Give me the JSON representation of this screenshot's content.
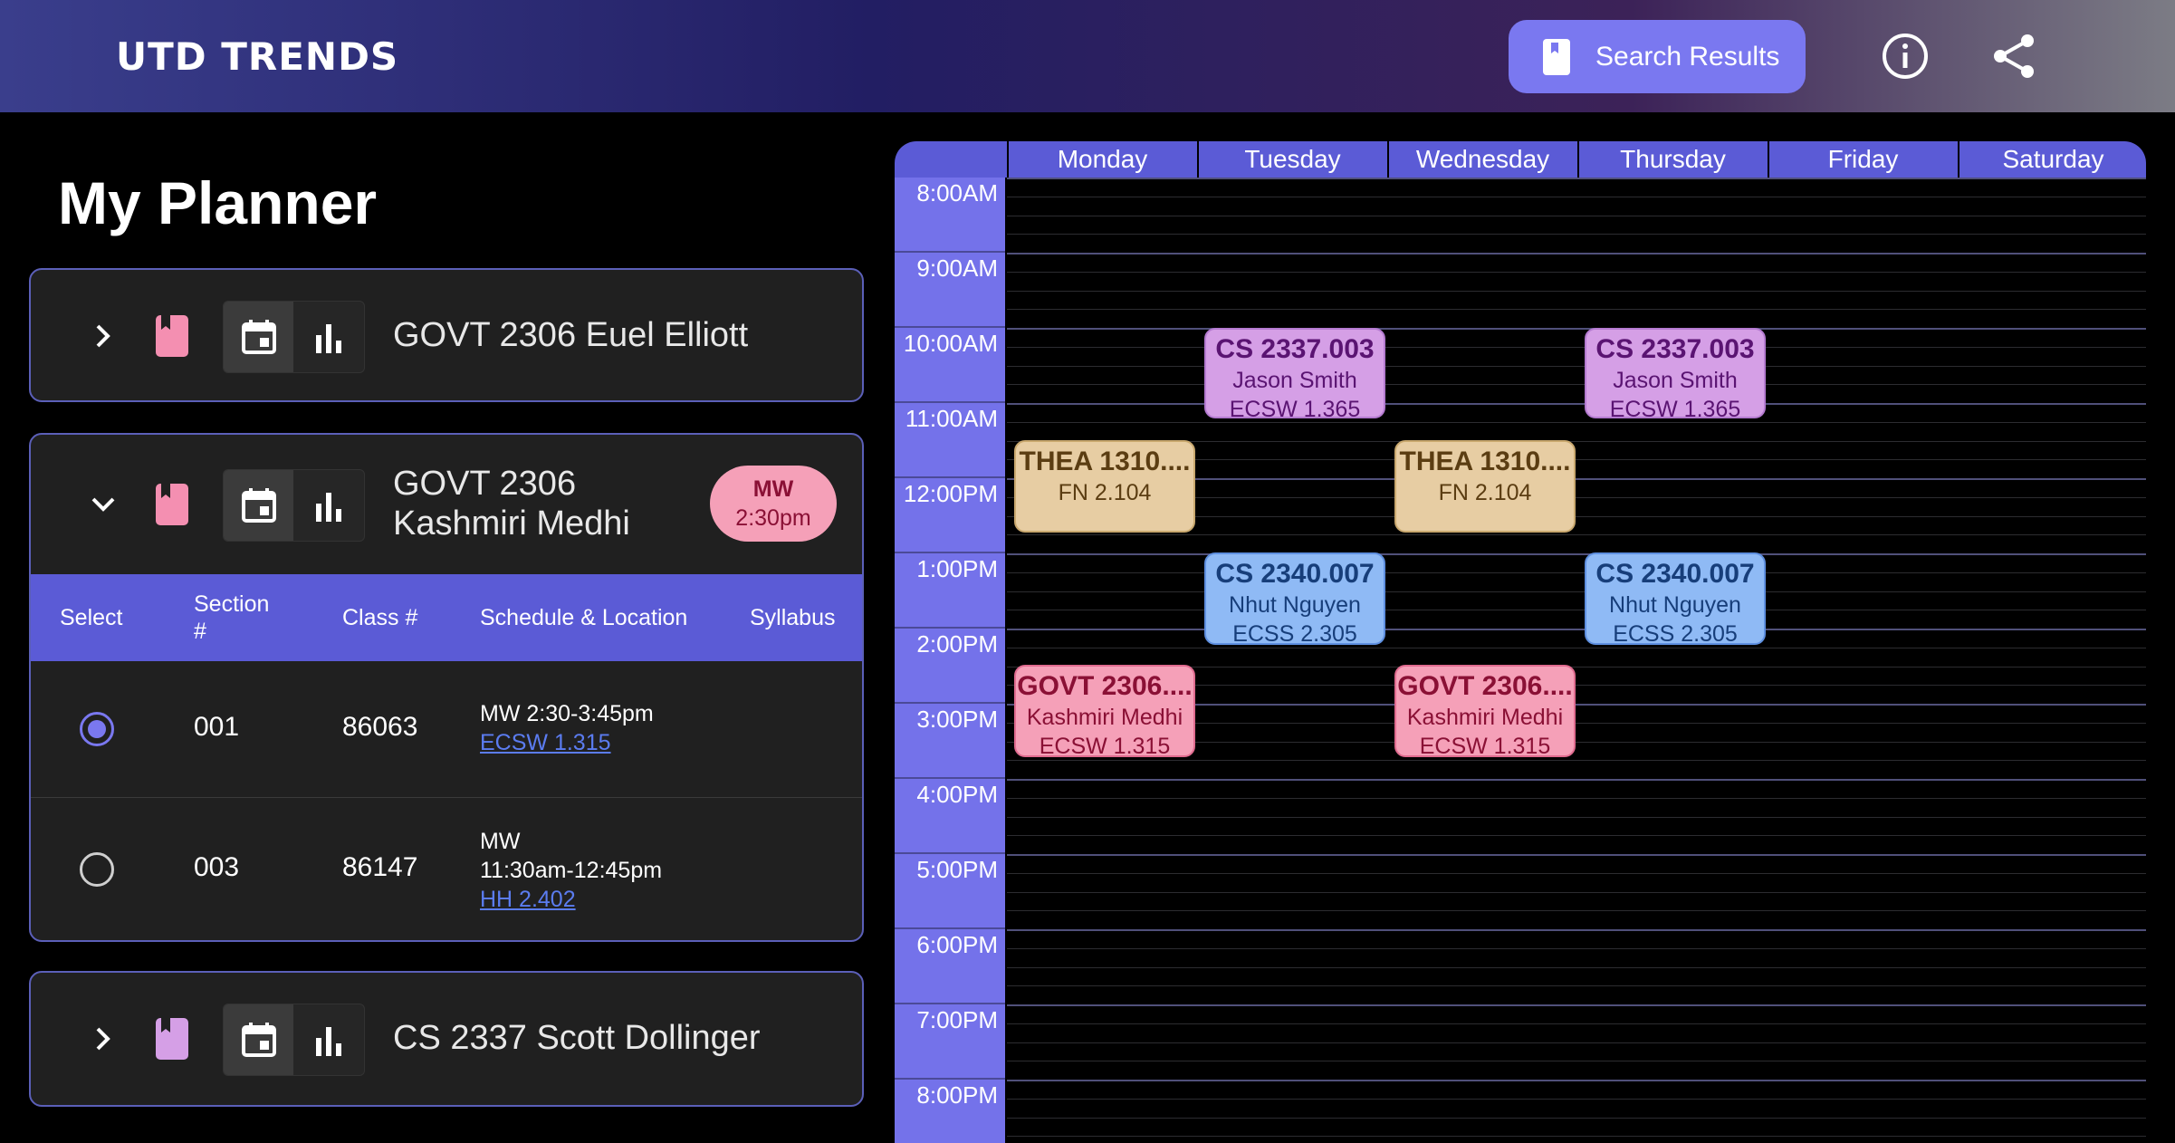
{
  "header": {
    "brand": "UTD TRENDS",
    "search_results_label": "Search Results"
  },
  "planner": {
    "title": "My Planner",
    "courses": [
      {
        "title": "GOVT 2306 Euel Elliott",
        "expanded": false,
        "bookmark_color": "#f48fb1"
      },
      {
        "title_line1": "GOVT 2306",
        "title_line2": "Kashmiri Medhi",
        "expanded": true,
        "bookmark_color": "#f48fb1",
        "badge": {
          "days": "MW",
          "time": "2:30pm"
        },
        "table": {
          "headers": {
            "select": "Select",
            "section": "Section #",
            "class_no": "Class #",
            "schedule": "Schedule & Location",
            "syllabus": "Syllabus"
          },
          "rows": [
            {
              "selected": true,
              "section": "001",
              "class_no": "86063",
              "schedule": "MW 2:30-3:45pm",
              "location": "ECSW 1.315"
            },
            {
              "selected": false,
              "section": "003",
              "class_no": "86147",
              "schedule_line1": "MW",
              "schedule_line2": "11:30am-12:45pm",
              "location": "HH 2.402"
            }
          ]
        }
      },
      {
        "title": "CS 2337 Scott Dollinger",
        "expanded": false,
        "bookmark_color": "#d59fe6"
      }
    ]
  },
  "calendar": {
    "days": [
      "Monday",
      "Tuesday",
      "Wednesday",
      "Thursday",
      "Friday",
      "Saturday"
    ],
    "times": [
      "8:00AM",
      "9:00AM",
      "10:00AM",
      "11:00AM",
      "12:00PM",
      "1:00PM",
      "2:00PM",
      "3:00PM",
      "4:00PM",
      "5:00PM",
      "6:00PM",
      "7:00PM",
      "8:00PM"
    ],
    "events": {
      "cs2337_tue": {
        "title": "CS 2337.003",
        "instructor": "Jason Smith",
        "location": "ECSW 1.365"
      },
      "cs2337_thu": {
        "title": "CS 2337.003",
        "instructor": "Jason Smith",
        "location": "ECSW 1.365"
      },
      "thea_mon": {
        "title": "THEA 1310....",
        "location": "FN 2.104"
      },
      "thea_wed": {
        "title": "THEA 1310....",
        "location": "FN 2.104"
      },
      "cs2340_tue": {
        "title": "CS 2340.007",
        "instructor": "Nhut Nguyen",
        "location": "ECSS 2.305"
      },
      "cs2340_thu": {
        "title": "CS 2340.007",
        "instructor": "Nhut Nguyen",
        "location": "ECSS 2.305"
      },
      "govt_mon": {
        "title": "GOVT 2306....",
        "instructor": "Kashmiri Medhi",
        "location": "ECSW 1.315"
      },
      "govt_wed": {
        "title": "GOVT 2306....",
        "instructor": "Kashmiri Medhi",
        "location": "ECSW 1.315"
      }
    }
  }
}
